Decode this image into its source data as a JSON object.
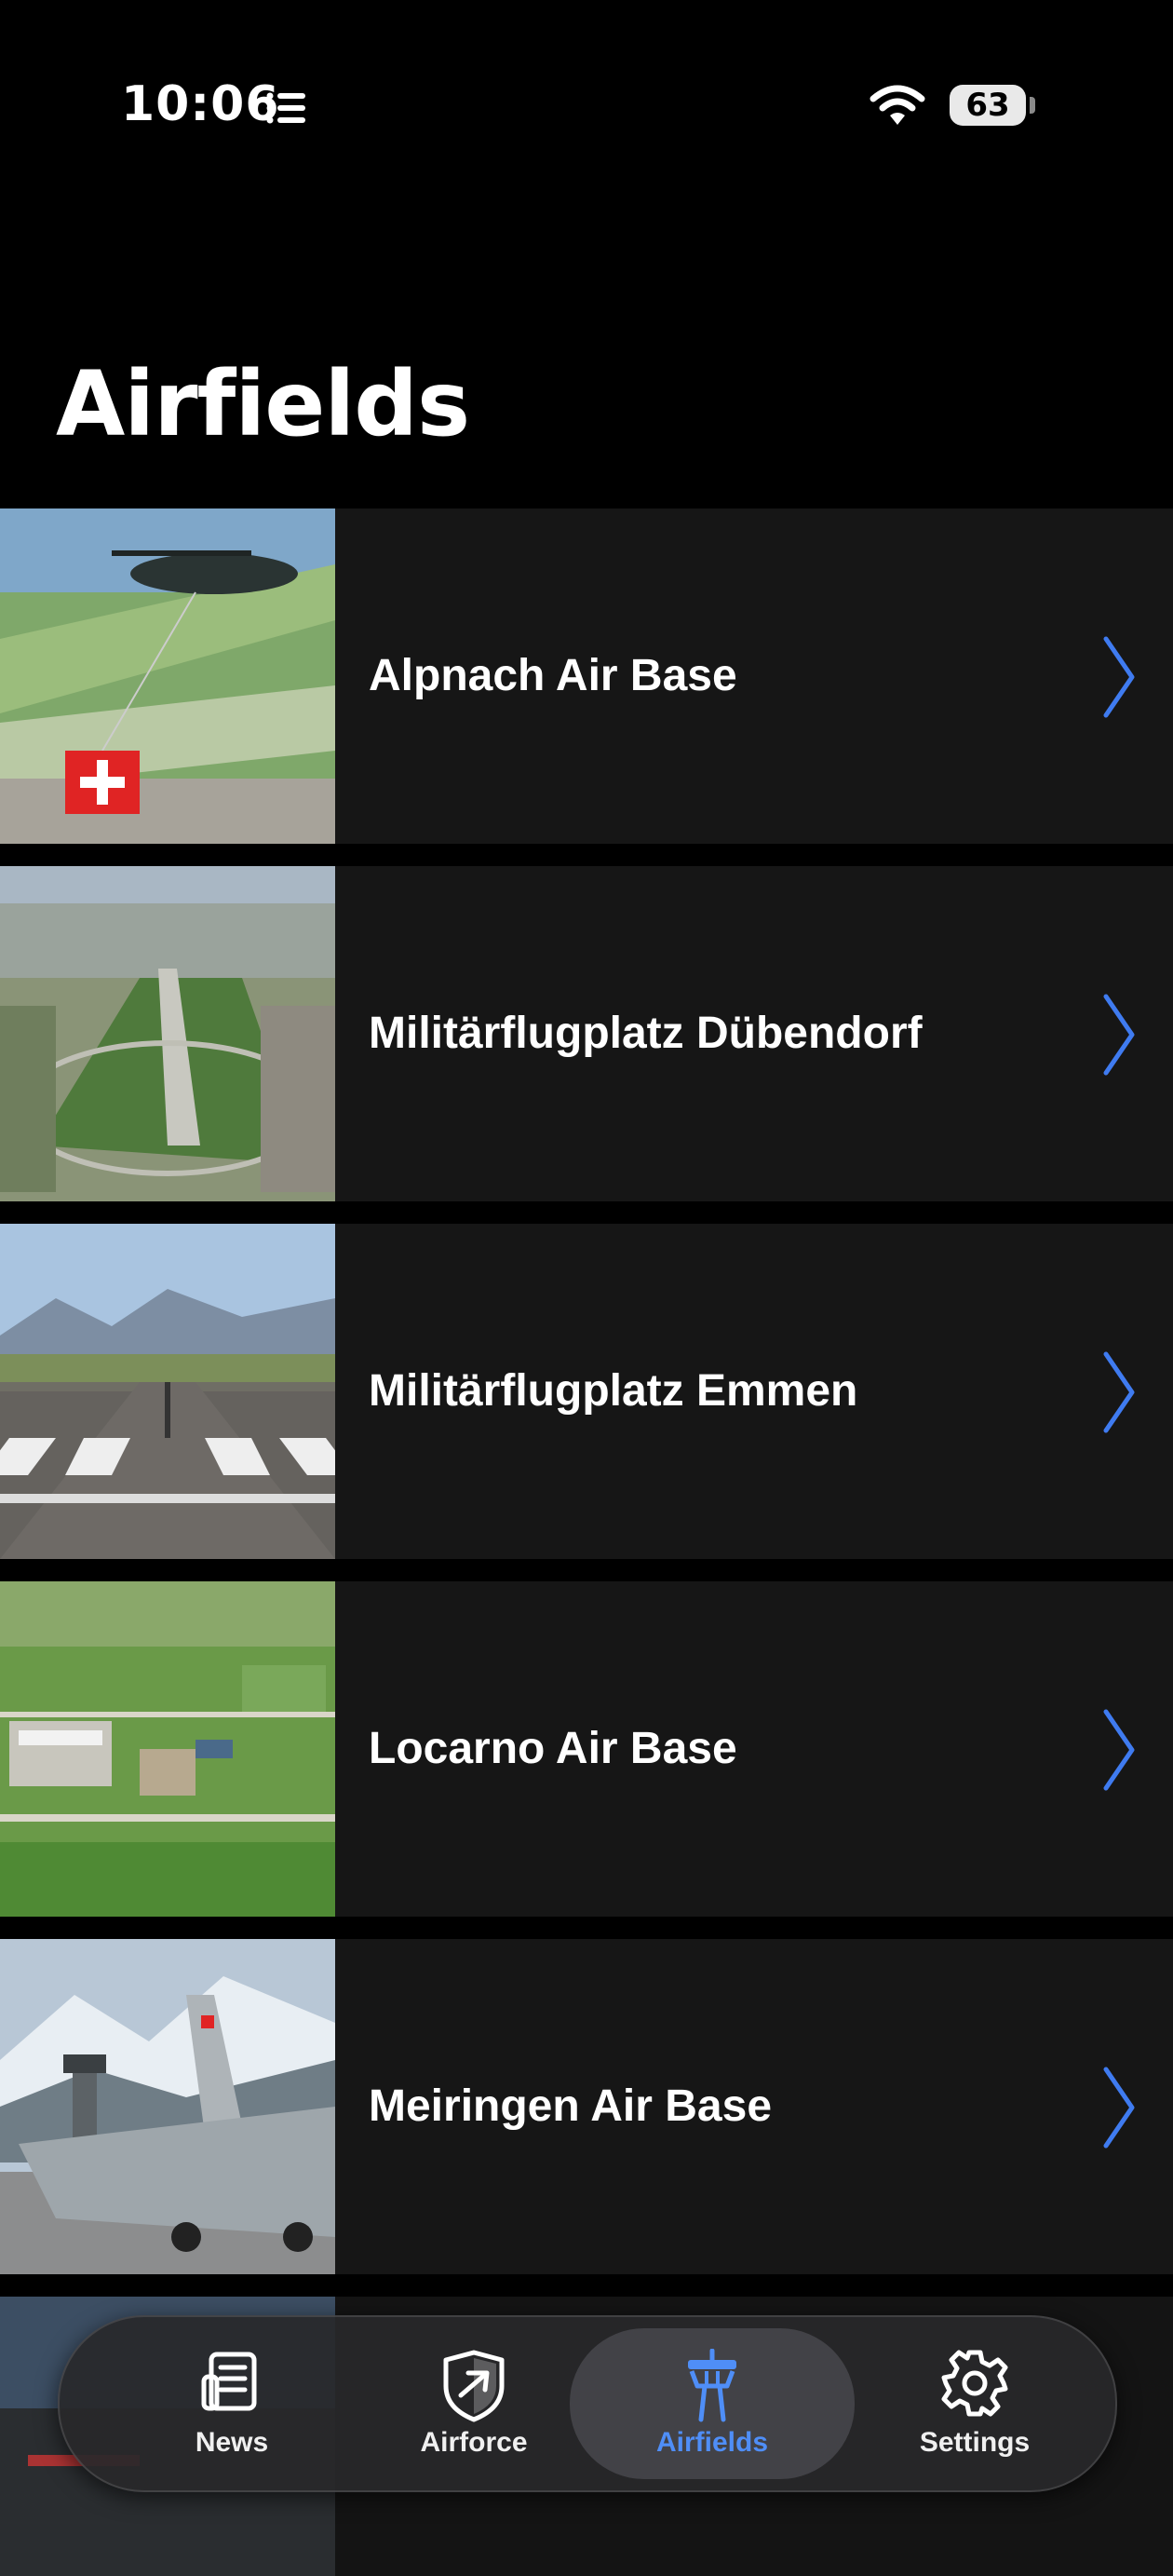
{
  "status_bar": {
    "time": "10:06",
    "battery": "63"
  },
  "page": {
    "title": "Airfields"
  },
  "airfields": [
    {
      "name": "Alpnach Air Base"
    },
    {
      "name": "Militärflugplatz Dübendorf"
    },
    {
      "name": "Militärflugplatz Emmen"
    },
    {
      "name": "Locarno Air Base"
    },
    {
      "name": "Meiringen Air Base"
    }
  ],
  "tabs": [
    {
      "label": "News",
      "icon": "news-icon"
    },
    {
      "label": "Airforce",
      "icon": "airforce-shield-icon"
    },
    {
      "label": "Airfields",
      "icon": "control-tower-icon",
      "active": true
    },
    {
      "label": "Settings",
      "icon": "gear-icon"
    }
  ],
  "colors": {
    "accent": "#4f8ef7",
    "row_bg": "#161616",
    "background": "#000000"
  }
}
